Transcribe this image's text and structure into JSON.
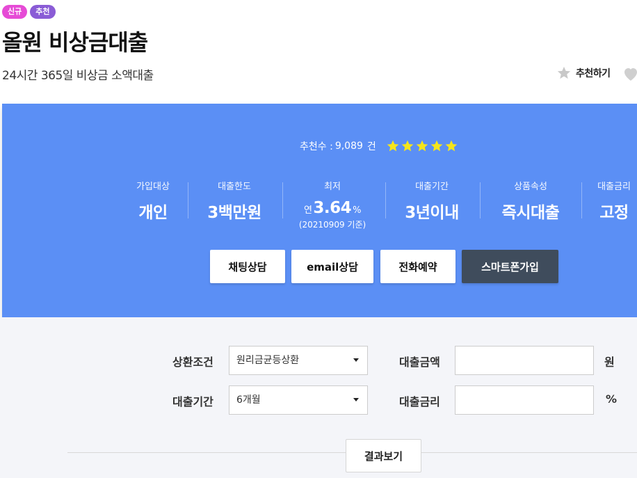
{
  "badges": {
    "new": "신규",
    "recommended": "추천"
  },
  "product": {
    "title": "올원 비상금대출",
    "subtitle": "24시간 365일 비상금 소액대출",
    "recommend_action": "추천하기"
  },
  "banner": {
    "recommend_prefix": "추천수 : ",
    "recommend_count": "9,089",
    "recommend_unit": "건",
    "rating": 5,
    "stats": [
      {
        "label": "가입대상",
        "value": "개인"
      },
      {
        "label": "대출한도",
        "value": "3백만원"
      },
      {
        "label": "최저",
        "value_prefix": "연",
        "value": "3.64",
        "value_suffix": "%",
        "note": "(20210909 기준)"
      },
      {
        "label": "대출기간",
        "value": "3년이내"
      },
      {
        "label": "상품속성",
        "value": "즉시대출"
      },
      {
        "label": "대출금리",
        "value": "고정"
      }
    ],
    "buttons": {
      "chat": "채팅상담",
      "email": "email상담",
      "phone": "전화예약",
      "smartphone": "스마트폰가입"
    }
  },
  "calculator": {
    "repayment_label": "상환조건",
    "repayment_selected": "원리금균등상환",
    "period_label": "대출기간",
    "period_selected": "6개월",
    "amount_label": "대출금액",
    "amount_value": "",
    "amount_unit": "원",
    "rate_label": "대출금리",
    "rate_value": "",
    "rate_unit": "%",
    "result_button": "결과보기"
  },
  "colors": {
    "banner": "#5b8ff5",
    "dark_button": "#3f4c5c",
    "star": "#f5e51b",
    "badge_new": "#e64bd6",
    "badge_rec": "#8a5cd6"
  }
}
